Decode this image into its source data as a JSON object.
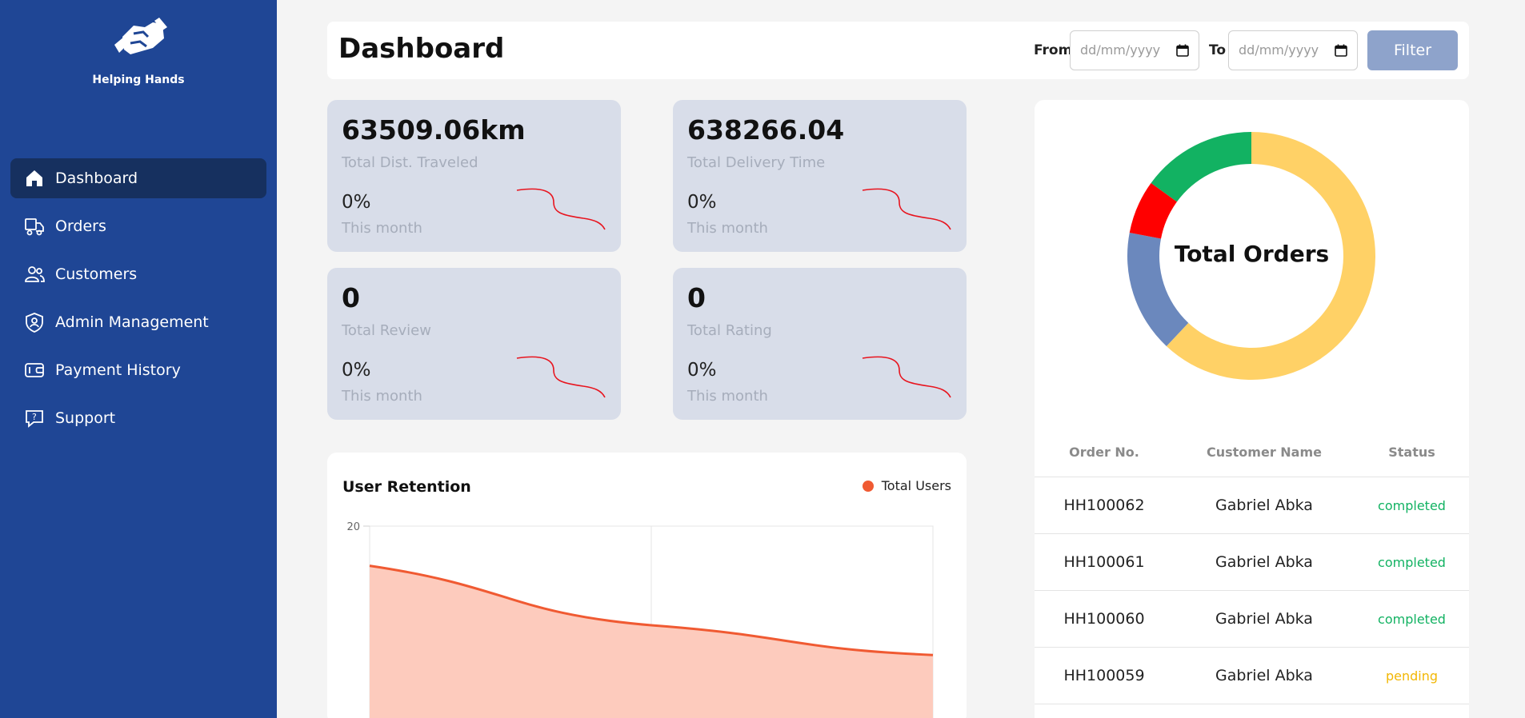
{
  "brand": {
    "name": "Helping Hands",
    "logo_icon": "handshake-icon"
  },
  "sidebar": {
    "items": [
      {
        "label": "Dashboard",
        "icon": "home-icon",
        "active": true
      },
      {
        "label": "Orders",
        "icon": "delivery-truck-icon",
        "active": false
      },
      {
        "label": "Customers",
        "icon": "users-icon",
        "active": false
      },
      {
        "label": "Admin Management",
        "icon": "shield-user-icon",
        "active": false
      },
      {
        "label": "Payment History",
        "icon": "wallet-icon",
        "active": false
      },
      {
        "label": "Support",
        "icon": "help-chat-icon",
        "active": false
      }
    ]
  },
  "header": {
    "title": "Dashboard",
    "from_label": "From",
    "to_label": "To",
    "from_placeholder": "dd/mm/yyyy",
    "to_placeholder": "dd/mm/yyyy",
    "filter_label": "Filter"
  },
  "stats": [
    {
      "value": "63509.06km",
      "label": "Total Dist. Traveled",
      "percent": "0%",
      "period": "This month"
    },
    {
      "value": "638266.04",
      "label": "Total Delivery Time",
      "percent": "0%",
      "period": "This month"
    },
    {
      "value": "0",
      "label": "Total Review",
      "percent": "0%",
      "period": "This month"
    },
    {
      "value": "0",
      "label": "Total Rating",
      "percent": "0%",
      "period": "This month"
    }
  ],
  "retention": {
    "title": "User Retention",
    "legend": "Total Users"
  },
  "chart_data": [
    {
      "type": "area",
      "title": "User Retention",
      "series": [
        {
          "name": "Total Users",
          "values": [
            16,
            10,
            7
          ]
        }
      ],
      "y_tick_labels": [
        "20"
      ],
      "ylim": [
        0,
        20
      ],
      "grid": true,
      "legend": "top-right",
      "colors": {
        "line": "#f05a32",
        "fill": "#fdcbbd"
      }
    },
    {
      "type": "pie",
      "title": "Total Orders",
      "donut": true,
      "values": [
        62,
        16,
        7,
        15
      ],
      "colors": [
        "#ffd166",
        "#6b88bd",
        "#ff0000",
        "#12b262"
      ]
    }
  ],
  "orders": {
    "headers": [
      "Order No.",
      "Customer Name",
      "Status"
    ],
    "rows": [
      {
        "order_no": "HH100062",
        "customer": "Gabriel Abka",
        "status": "completed"
      },
      {
        "order_no": "HH100061",
        "customer": "Gabriel Abka",
        "status": "completed"
      },
      {
        "order_no": "HH100060",
        "customer": "Gabriel Abka",
        "status": "completed"
      },
      {
        "order_no": "HH100059",
        "customer": "Gabriel Abka",
        "status": "pending"
      }
    ]
  },
  "colors": {
    "sidebar": "#1f4695",
    "sidebar_active": "#16305f",
    "completed": "#12b262",
    "pending": "#f2b705",
    "filter_button": "#8ea3cb"
  }
}
